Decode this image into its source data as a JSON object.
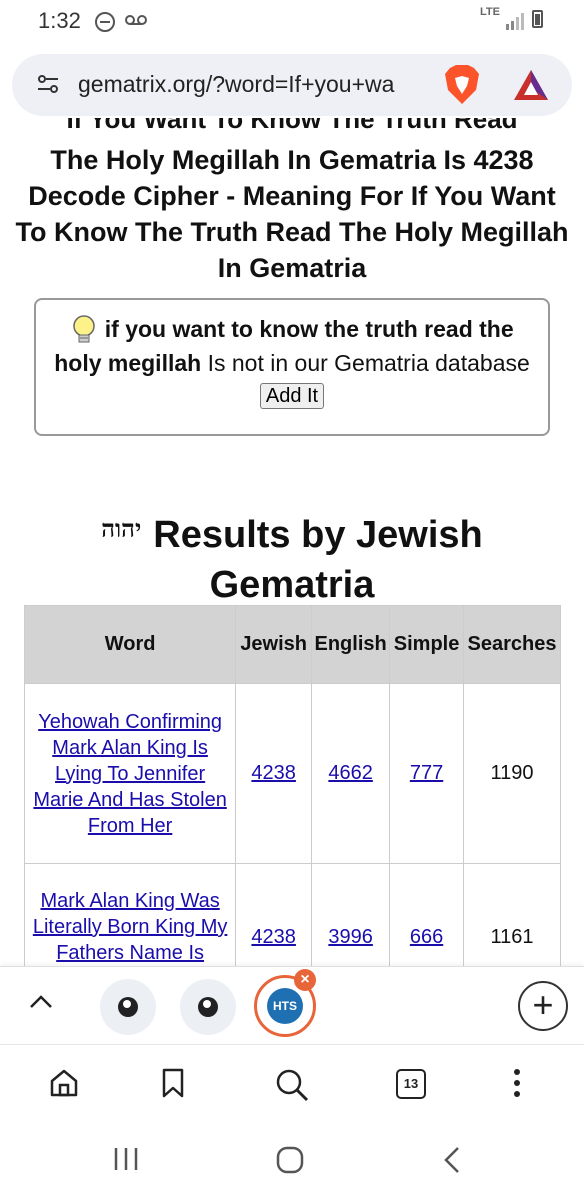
{
  "status_bar": {
    "time": "1:32",
    "network": "LTE"
  },
  "browser": {
    "url": "gematrix.org/?word=If+you+wa",
    "tab_count": "13",
    "open_tab_label": "HTS"
  },
  "page": {
    "cut_title": "If You Want To Know The Truth Read",
    "headline": "The Holy Megillah In Gematria Is 4238 Decode Cipher - Meaning For If You Want To Know The Truth Read The Holy Megillah In Gematria",
    "notice": {
      "phrase": "if you want to know the truth read the holy megillah",
      "message": " Is not in our Gematria database ",
      "add_button": "Add It"
    },
    "results_heading": {
      "hebrew": "יהוה",
      "text": "Results by Jewish Gematria"
    },
    "table": {
      "headers": [
        "Word",
        "Jewish",
        "English",
        "Simple",
        "Searches"
      ],
      "rows": [
        {
          "word": "Yehowah Confirming Mark Alan King Is Lying To Jennifer Marie And Has Stolen From Her",
          "jewish": "4238",
          "english": "4662",
          "simple": "777",
          "searches": "1190"
        },
        {
          "word": "Mark Alan King Was Literally Born King My Fathers Name Is",
          "jewish": "4238",
          "english": "3996",
          "simple": "666",
          "searches": "1161"
        }
      ]
    }
  },
  "icons": {
    "status": [
      "do-not-disturb-icon",
      "voicemail-icon",
      "signal-icon",
      "battery-icon"
    ],
    "url_bar": [
      "page-settings-icon",
      "brave-shields-icon",
      "brave-rewards-icon"
    ],
    "tab_strip": [
      "chevron-up-icon",
      "globe-icon",
      "globe-icon",
      "hts-favicon",
      "close-icon",
      "plus-icon"
    ],
    "nav": [
      "home-icon",
      "bookmark-icon",
      "search-icon",
      "tabs-icon",
      "more-icon"
    ],
    "android": [
      "recents-icon",
      "home-circle-icon",
      "back-icon"
    ]
  },
  "colors": {
    "link": "#1a0dab",
    "table_header_bg": "#d3d3d3",
    "brave_orange": "#fb542b",
    "hts_ring": "#e8653a",
    "hts_blue": "#1f6fb3"
  }
}
